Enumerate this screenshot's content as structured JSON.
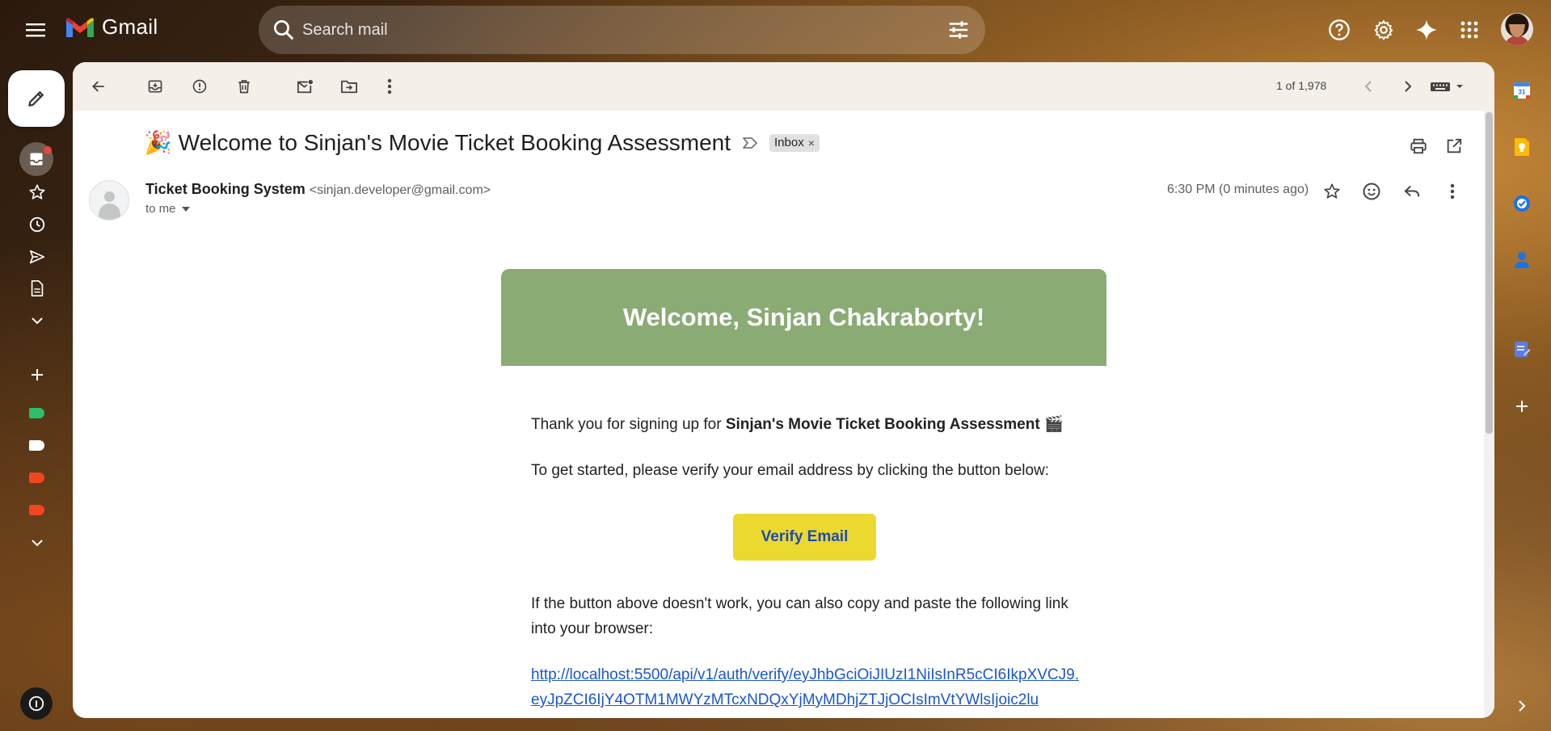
{
  "app": {
    "name": "Gmail"
  },
  "search": {
    "placeholder": "Search mail"
  },
  "toolbar": {
    "pager": "1 of 1,978"
  },
  "email": {
    "subject": "🎉 Welcome to Sinjan's Movie Ticket Booking Assessment",
    "label_chip": "Inbox",
    "label_chip_close": "×",
    "sender_name": "Ticket Booking System",
    "sender_email": "<sinjan.developer@gmail.com>",
    "recipient": "to me",
    "timestamp": "6:30 PM (0 minutes ago)"
  },
  "body": {
    "banner_heading": "Welcome, Sinjan Chakraborty!",
    "thanks_prefix": "Thank you for signing up for ",
    "thanks_bold": "Sinjan's Movie Ticket Booking Assessment",
    "thanks_emoji": "🎬",
    "instruction": "To get started, please verify your email address by clicking the button below:",
    "verify_button": "Verify Email",
    "fallback_line1": "If the button above doesn't work, you can also copy and paste the following link",
    "fallback_line2": "into your browser:",
    "link_line1": "http://localhost:5500/api/v1/auth/verify/eyJhbGciOiJIUzI1NiIsInR5cCI6IkpXVCJ9.",
    "link_line2": "eyJpZCI6IjY4OTM1MWYzMTcxNDQxYjMyMDhjZTJjOCIsImVtYWlsIjoic2lu"
  },
  "colors": {
    "banner": "#8aab74",
    "verify_button": "#ecd930",
    "link": "#1a57c9",
    "label_green": "#2dbd6e",
    "label_red": "#f0461f",
    "label_white": "#ffffff"
  },
  "rail_icons": [
    "inbox-icon",
    "star-icon",
    "clock-icon",
    "send-icon",
    "draft-icon",
    "chevron-down-icon",
    "plus-icon"
  ],
  "side_panel_icons": [
    "calendar-icon",
    "keep-icon",
    "tasks-icon",
    "contacts-icon",
    "notes-icon",
    "plus-icon"
  ]
}
